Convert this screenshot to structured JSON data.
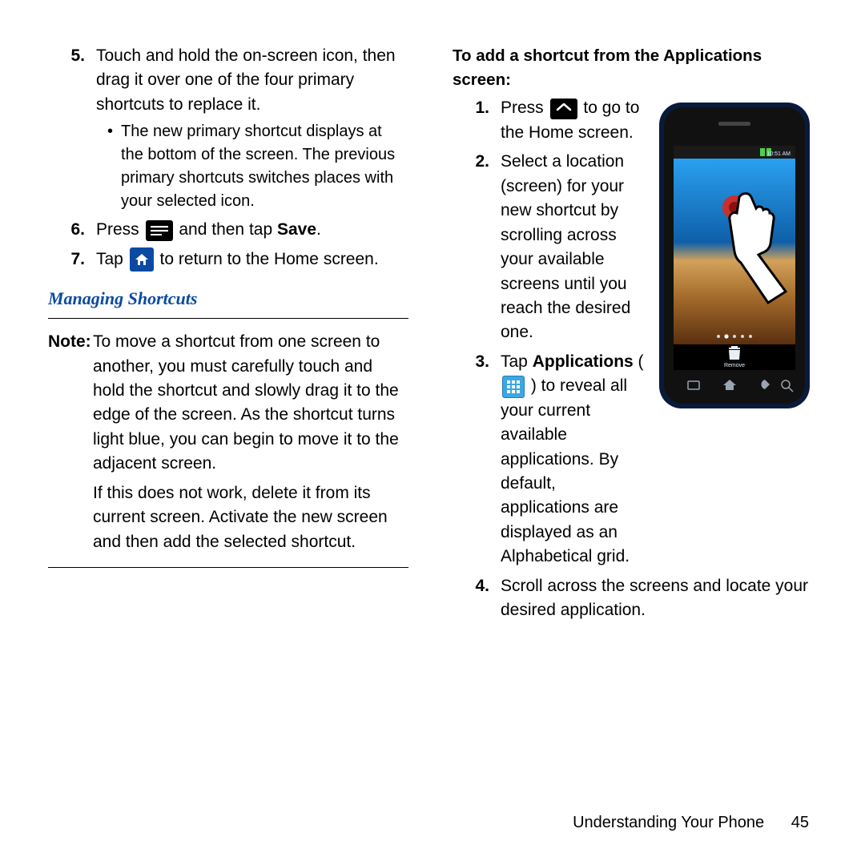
{
  "left": {
    "items": [
      {
        "num": "5.",
        "text": "Touch and hold the on-screen icon, then drag it over one of the four primary shortcuts to replace it.",
        "bullet": "The new primary shortcut displays at the bottom of the screen. The previous primary shortcuts switches places with your selected icon."
      },
      {
        "num": "6.",
        "pre": "Press ",
        "post": " and then tap ",
        "bold": "Save",
        "tail": "."
      },
      {
        "num": "7.",
        "pre": "Tap ",
        "post": " to return to the Home screen."
      }
    ],
    "heading": "Managing Shortcuts",
    "note_label": "Note:",
    "note_p1": "To move a shortcut from one screen to another, you must carefully touch and hold the shortcut and slowly drag it to the edge of the screen. As the shortcut turns light blue, you can begin to move it to the adjacent screen.",
    "note_p2": "If this does not work, delete it from its current screen. Activate the new screen and then add the selected shortcut."
  },
  "right": {
    "heading": "To add a shortcut from the Applications screen:",
    "items": [
      {
        "num": "1.",
        "pre": "Press ",
        "post": " to go to the Home screen."
      },
      {
        "num": "2.",
        "text": "Select a location (screen) for your new shortcut by scrolling across your available screens until you reach the desired one."
      },
      {
        "num": "3.",
        "pre": "Tap ",
        "bold": "Applications",
        "paren_open": " (",
        "paren_close": ") ",
        "post": "to reveal all your current available applications. By default, applications are displayed as an Alphabetical grid."
      },
      {
        "num": "4.",
        "text": "Scroll across the screens and locate your desired application."
      }
    ],
    "phone_time": "10:51 AM",
    "phone_remove": "Remove"
  },
  "footer": {
    "section": "Understanding Your Phone",
    "page": "45"
  }
}
